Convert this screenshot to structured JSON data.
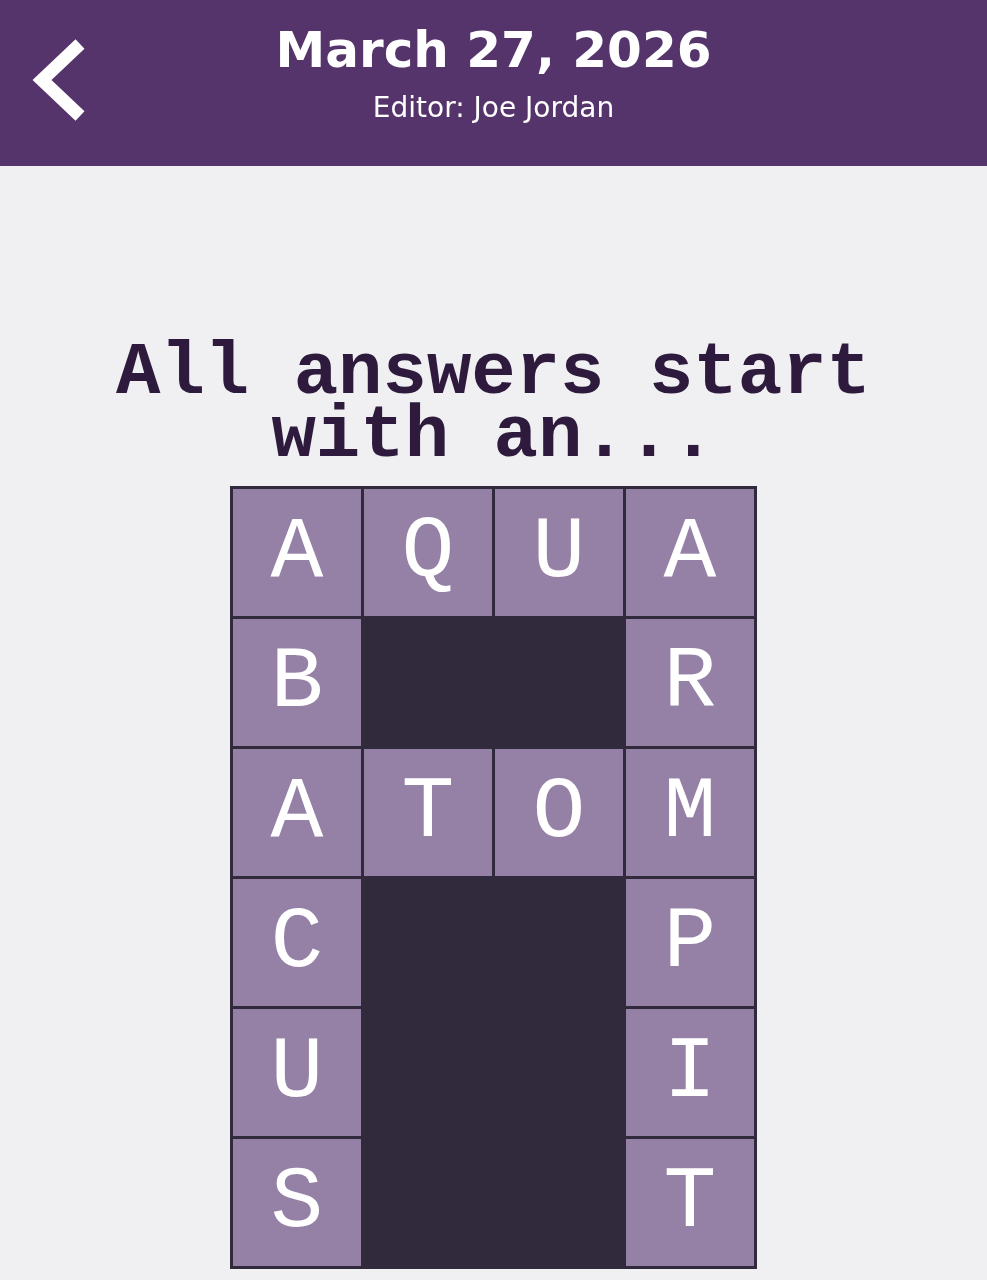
{
  "header": {
    "title": "March 27, 2026",
    "subtitle": "Editor: Joe Jordan"
  },
  "prompt": "All answers start with an...",
  "grid": {
    "rows": [
      [
        {
          "kind": "letter",
          "letter": "A"
        },
        {
          "kind": "letter",
          "letter": "Q"
        },
        {
          "kind": "letter",
          "letter": "U"
        },
        {
          "kind": "letter",
          "letter": "A"
        }
      ],
      [
        {
          "kind": "letter",
          "letter": "B"
        },
        {
          "kind": "block"
        },
        {
          "kind": "block"
        },
        {
          "kind": "letter",
          "letter": "R"
        }
      ],
      [
        {
          "kind": "letter",
          "letter": "A"
        },
        {
          "kind": "letter",
          "letter": "T"
        },
        {
          "kind": "letter",
          "letter": "O"
        },
        {
          "kind": "letter",
          "letter": "M"
        }
      ],
      [
        {
          "kind": "letter",
          "letter": "C"
        },
        {
          "kind": "block"
        },
        {
          "kind": "block"
        },
        {
          "kind": "letter",
          "letter": "P"
        }
      ],
      [
        {
          "kind": "letter",
          "letter": "U"
        },
        {
          "kind": "block"
        },
        {
          "kind": "block"
        },
        {
          "kind": "letter",
          "letter": "I"
        }
      ],
      [
        {
          "kind": "letter",
          "letter": "S"
        },
        {
          "kind": "block"
        },
        {
          "kind": "block"
        },
        {
          "kind": "letter",
          "letter": "T"
        }
      ]
    ]
  }
}
